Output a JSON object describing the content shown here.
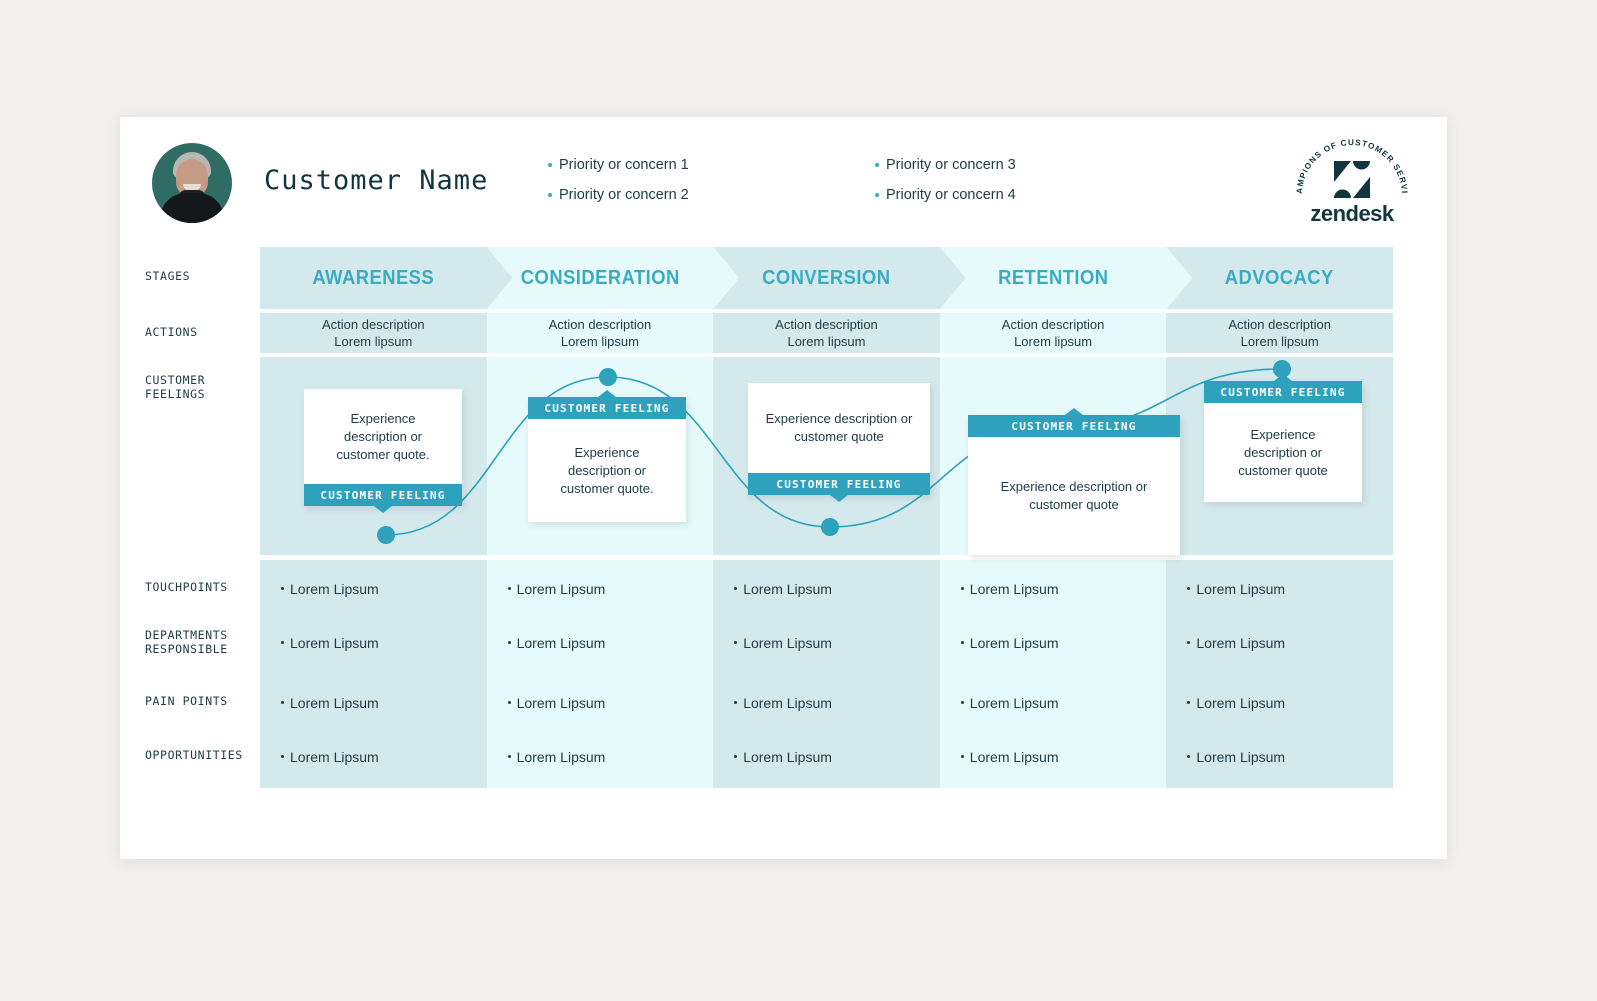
{
  "header": {
    "customer_name": "Customer Name",
    "avatar": "customer-avatar-photo",
    "priorities_left": [
      "Priority or concern 1",
      "Priority or concern 2"
    ],
    "priorities_right": [
      "Priority or concern 3",
      "Priority or concern 4"
    ],
    "logo": {
      "arc_text": "CHAMPIONS OF CUSTOMER SERVICE",
      "wordmark": "zendesk"
    }
  },
  "row_labels": {
    "stages": "STAGES",
    "actions": "ACTIONS",
    "customer_feelings_line1": "CUSTOMER",
    "customer_feelings_line2": "FEELINGS",
    "touchpoints": "TOUCHPOINTS",
    "departments_line1": "DEPARTMENTS",
    "departments_line2": "RESPONSIBLE",
    "pain_points": "PAIN POINTS",
    "opportunities": "OPPORTUNITIES"
  },
  "stages": [
    "AWARENESS",
    "CONSIDERATION",
    "CONVERSION",
    "RETENTION",
    "ADVOCACY"
  ],
  "actions": [
    {
      "line1": "Action description",
      "line2": "Lorem lipsum"
    },
    {
      "line1": "Action description",
      "line2": "Lorem lipsum"
    },
    {
      "line1": "Action description",
      "line2": "Lorem lipsum"
    },
    {
      "line1": "Action description",
      "line2": "Lorem lipsum"
    },
    {
      "line1": "Action description",
      "line2": "Lorem lipsum"
    }
  ],
  "feelings": [
    {
      "bar": "CUSTOMER FEELING",
      "bar_position": "bottom",
      "text": "Experience description or customer quote."
    },
    {
      "bar": "CUSTOMER FEELING",
      "bar_position": "top",
      "text": "Experience description or customer quote."
    },
    {
      "bar": "CUSTOMER FEELING",
      "bar_position": "bottom",
      "text": "Experience description or customer quote"
    },
    {
      "bar": "CUSTOMER FEELING",
      "bar_position": "top",
      "text": "Experience description or customer quote"
    },
    {
      "bar": "CUSTOMER FEELING",
      "bar_position": "top",
      "text": "Experience description or customer quote"
    }
  ],
  "touchpoints": [
    "Lorem Lipsum",
    "Lorem Lipsum",
    "Lorem Lipsum",
    "Lorem Lipsum",
    "Lorem Lipsum"
  ],
  "departments": [
    "Lorem Lipsum",
    "Lorem Lipsum",
    "Lorem Lipsum",
    "Lorem Lipsum",
    "Lorem Lipsum"
  ],
  "pain_points": [
    "Lorem Lipsum",
    "Lorem Lipsum",
    "Lorem Lipsum",
    "Lorem Lipsum",
    "Lorem Lipsum"
  ],
  "opportunities": [
    "Lorem Lipsum",
    "Lorem Lipsum",
    "Lorem Lipsum",
    "Lorem Lipsum",
    "Lorem Lipsum"
  ],
  "colors": {
    "accent_teal": "#3aacc1",
    "bar_teal": "#2ea2bd",
    "ink": "#1d3c46",
    "column_dark": "#d4e9ec",
    "column_light": "#e6fafb",
    "page_bg": "#f2efed"
  }
}
